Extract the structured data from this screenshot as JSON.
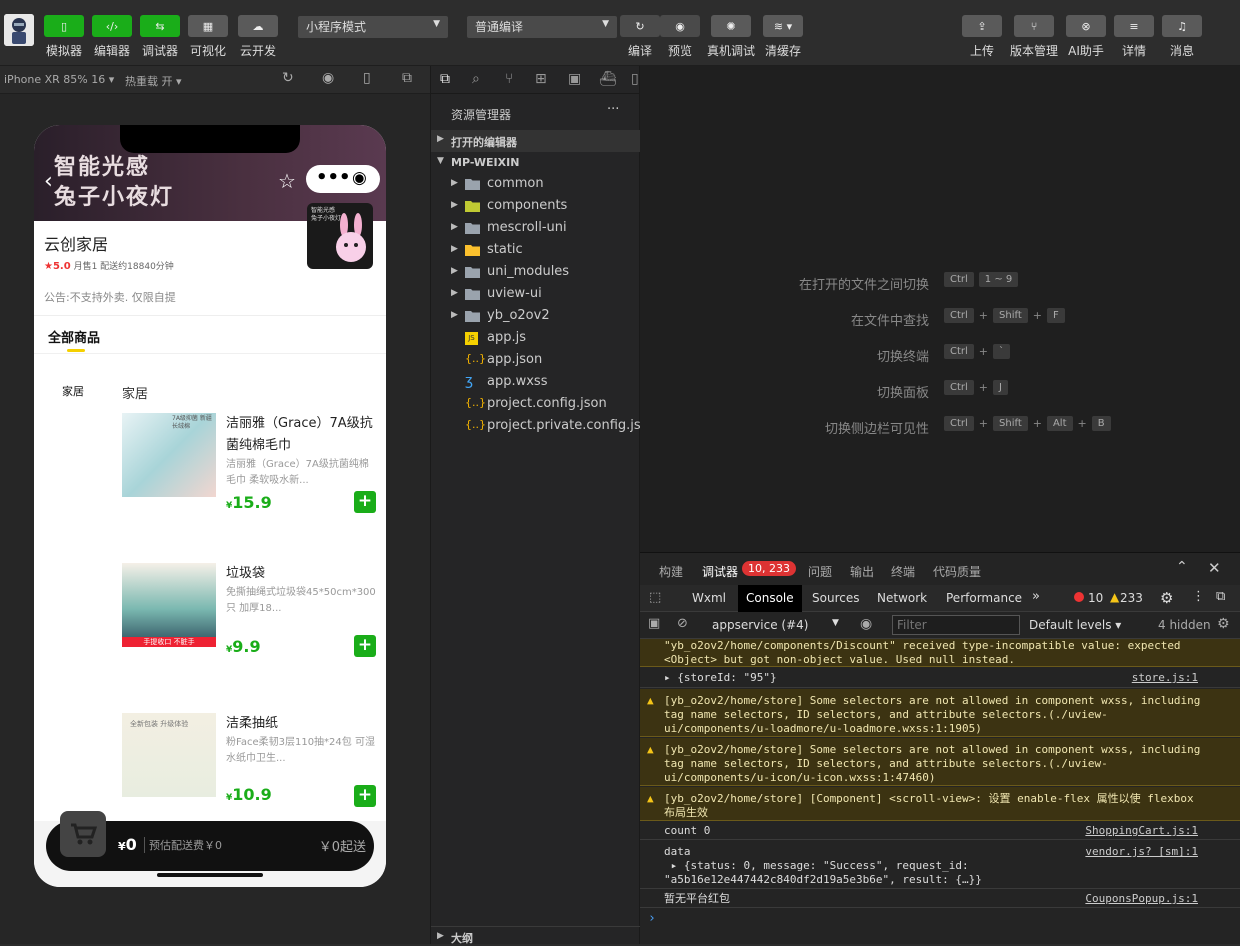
{
  "toolbar": {
    "buttons": [
      {
        "label": "模拟器",
        "icon": "phone-icon"
      },
      {
        "label": "编辑器",
        "icon": "code-icon"
      },
      {
        "label": "调试器",
        "icon": "debug-icon"
      },
      {
        "label": "可视化",
        "icon": "layout-icon"
      },
      {
        "label": "云开发",
        "icon": "cloud-icon"
      }
    ],
    "mode_select": "小程序模式",
    "compile_select": "普通编译",
    "mid_buttons": [
      {
        "label": "编译",
        "icon": "refresh-icon"
      },
      {
        "label": "预览",
        "icon": "eye-icon"
      },
      {
        "label": "真机调试",
        "icon": "bug-icon"
      },
      {
        "label": "清缓存",
        "icon": "layers-icon"
      }
    ],
    "right_buttons": [
      {
        "label": "上传",
        "icon": "upload-icon"
      },
      {
        "label": "版本管理",
        "icon": "branch-icon"
      },
      {
        "label": "AI助手",
        "icon": "ai-icon"
      },
      {
        "label": "详情",
        "icon": "menu-icon"
      },
      {
        "label": "消息",
        "icon": "bell-icon"
      }
    ]
  },
  "simulator": {
    "device": "iPhone XR 85% 16 ▾",
    "hot_reload": "热重载 开 ▾"
  },
  "phone": {
    "banner_text_1": "智能光感",
    "banner_text_2": "兔子小夜灯",
    "thumb_text": "智能光感 兔子小夜灯",
    "store_name": "云创家居",
    "rating": "★5.0",
    "monthly": "月售1",
    "delivery": "配送约18840分钟",
    "notice": "公告:不支持外卖. 仅限自提",
    "tab": "全部商品",
    "category": "家居",
    "section": "家居",
    "products": [
      {
        "name": "洁丽雅（Grace）7A级抗菌纯棉毛巾",
        "desc": "洁丽雅（Grace）7A级抗菌纯棉毛巾 柔软吸水新...",
        "price": "15.9",
        "img_text": "7A级抑菌 新疆长绒棉"
      },
      {
        "name": "垃圾袋",
        "desc": "免撕抽绳式垃圾袋45*50cm*300只 加厚18...",
        "price": "9.9",
        "img_text": "手提收口 不脏手"
      },
      {
        "name": "洁柔抽纸",
        "desc": "粉Face柔韧3层110抽*24包 可湿水纸巾卫生...",
        "price": "10.9",
        "img_text": "全新包装 升级体验"
      }
    ],
    "currency": "¥",
    "cart_total": "0",
    "cart_delivery": "预估配送费￥0",
    "min_order": "￥0起送"
  },
  "explorer": {
    "title": "资源管理器",
    "more": "···",
    "open_editors": "打开的编辑器",
    "project": "MP-WEIXIN",
    "outline": "大纲",
    "folders": [
      "common",
      "components",
      "mescroll-uni",
      "static",
      "uni_modules",
      "uview-ui",
      "yb_o2ov2"
    ],
    "files": [
      {
        "name": "app.js",
        "type": "js"
      },
      {
        "name": "app.json",
        "type": "json"
      },
      {
        "name": "app.wxss",
        "type": "css"
      },
      {
        "name": "project.config.json",
        "type": "json"
      },
      {
        "name": "project.private.config.json",
        "type": "json"
      }
    ]
  },
  "shortcuts": [
    {
      "name": "在打开的文件之间切换",
      "keys": [
        "Ctrl",
        "1 ~ 9"
      ]
    },
    {
      "name": "在文件中查找",
      "keys": [
        "Ctrl",
        "Shift",
        "F"
      ]
    },
    {
      "name": "切换终端",
      "keys": [
        "Ctrl",
        "`"
      ]
    },
    {
      "name": "切换面板",
      "keys": [
        "Ctrl",
        "J"
      ]
    },
    {
      "name": "切换侧边栏可见性",
      "keys": [
        "Ctrl",
        "Shift",
        "Alt",
        "B"
      ]
    }
  ],
  "debug": {
    "tabs": [
      "构建",
      "调试器",
      "问题",
      "输出",
      "终端",
      "代码质量"
    ],
    "badge": "10, 233",
    "devtabs": [
      "Wxml",
      "Console",
      "Sources",
      "Network",
      "Performance"
    ],
    "errors": "10",
    "warnings": "233",
    "context": "appservice (#4)",
    "filter_placeholder": "Filter",
    "levels": "Default levels ▾",
    "hidden": "4 hidden",
    "prompt": "›"
  },
  "console_lines": [
    {
      "kind": "warn",
      "text": "\"yb_o2ov2/home/components/Discount\" received type-incompatible value: expected <Object> but got non-object value. Used null instead.",
      "src": ""
    },
    {
      "kind": "log",
      "text": "▸ {storeId: \"95\"}",
      "src": "store.js:1"
    },
    {
      "kind": "warn",
      "text": "[yb_o2ov2/home/store] Some selectors are not allowed in component wxss, including tag name selectors, ID selectors, and attribute selectors.(./uview-ui/components/u-loadmore/u-loadmore.wxss:1:1905)",
      "src": ""
    },
    {
      "kind": "warn",
      "text": "[yb_o2ov2/home/store] Some selectors are not allowed in component wxss, including tag name selectors, ID selectors, and attribute selectors.(./uview-ui/components/u-icon/u-icon.wxss:1:47460)",
      "src": ""
    },
    {
      "kind": "warn",
      "text": "[yb_o2ov2/home/store] [Component] <scroll-view>: 设置 enable-flex 属性以使 flexbox 布局生效",
      "src": ""
    },
    {
      "kind": "log",
      "text": "count 0",
      "src": "ShoppingCart.js:1"
    },
    {
      "kind": "log",
      "text": "data\n ▸ {status: 0, message: \"Success\", request_id: \"a5b16e12e447442c840df2d19a5e3b6e\", result: {…}}",
      "src": "vendor.js? [sm]:1"
    },
    {
      "kind": "log",
      "text": "暂无平台红包",
      "src": "CouponsPopup.js:1"
    }
  ]
}
